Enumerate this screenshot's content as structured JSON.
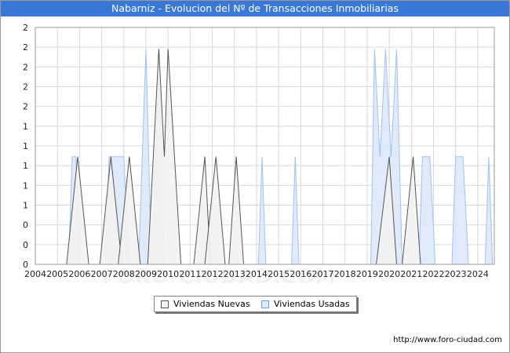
{
  "title": "Nabarniz - Evolucion del Nº de Transacciones Inmobiliarias",
  "source": "http://www.foro-ciudad.com",
  "watermark": "FORO-CIUDAD.COM",
  "legend": {
    "nuevas": "Viviendas Nuevas",
    "usadas": "Viviendas Usadas"
  },
  "colors": {
    "title_bg": "#3a78d8",
    "nuevas_fill": "#f2f2f2",
    "nuevas_stroke": "#555555",
    "usadas_fill": "#dbe9fb",
    "usadas_stroke": "#9dc3f0",
    "grid": "#d8d8d8"
  },
  "chart_data": {
    "type": "area",
    "title": "Nabarniz - Evolucion del Nº de Transacciones Inmobiliarias",
    "xlabel": "",
    "ylabel": "",
    "x_ticks": [
      "2004",
      "2005",
      "2006",
      "2007",
      "2008",
      "2009",
      "2010",
      "2011",
      "2012",
      "2013",
      "2014",
      "2015",
      "2016",
      "2017",
      "2018",
      "2019",
      "2020",
      "2021",
      "2022",
      "2023",
      "2024"
    ],
    "y_ticks": [
      "0",
      "0",
      "0",
      "1",
      "1",
      "1",
      "1",
      "1",
      "2",
      "2",
      "2",
      "2"
    ],
    "ylim": [
      0,
      2.2
    ],
    "grid": true,
    "legend_position": "bottom",
    "series": [
      {
        "name": "Viviendas Usadas",
        "points": [
          [
            "2005-07",
            0
          ],
          [
            "2005-09",
            1
          ],
          [
            "2005-11",
            1
          ],
          [
            "2006-01",
            0
          ],
          [
            "2007-03",
            0
          ],
          [
            "2007-05",
            1
          ],
          [
            "2007-08",
            1
          ],
          [
            "2007-10",
            1
          ],
          [
            "2008-01",
            1
          ],
          [
            "2008-04",
            0
          ],
          [
            "2008-09",
            0
          ],
          [
            "2009-01",
            2
          ],
          [
            "2009-04",
            0
          ],
          [
            "2009-05",
            0
          ],
          [
            "2009-08",
            2
          ],
          [
            "2009-11",
            0
          ],
          [
            "2014-02",
            0
          ],
          [
            "2014-04",
            1
          ],
          [
            "2014-06",
            0
          ],
          [
            "2015-08",
            0
          ],
          [
            "2015-10",
            1
          ],
          [
            "2015-12",
            0
          ],
          [
            "2019-03",
            0
          ],
          [
            "2019-05",
            2
          ],
          [
            "2019-08",
            1
          ],
          [
            "2019-11",
            2
          ],
          [
            "2020-02",
            1
          ],
          [
            "2020-05",
            2
          ],
          [
            "2020-08",
            0
          ],
          [
            "2021-05",
            0
          ],
          [
            "2021-07",
            1
          ],
          [
            "2021-11",
            1
          ],
          [
            "2022-02",
            0
          ],
          [
            "2022-11",
            0
          ],
          [
            "2023-01",
            1
          ],
          [
            "2023-05",
            1
          ],
          [
            "2023-08",
            0
          ],
          [
            "2024-05",
            0
          ],
          [
            "2024-07",
            1
          ],
          [
            "2024-09",
            0
          ]
        ]
      },
      {
        "name": "Viviendas Nuevas",
        "points": [
          [
            "2005-06",
            0
          ],
          [
            "2005-12",
            1
          ],
          [
            "2006-06",
            0
          ],
          [
            "2006-12",
            0
          ],
          [
            "2007-06",
            1
          ],
          [
            "2007-12",
            0
          ],
          [
            "2007-10",
            0
          ],
          [
            "2008-04",
            1
          ],
          [
            "2008-10",
            0
          ],
          [
            "2009-02",
            0
          ],
          [
            "2009-08",
            2
          ],
          [
            "2009-11",
            1
          ],
          [
            "2010-01",
            2
          ],
          [
            "2010-08",
            0
          ],
          [
            "2011-03",
            0
          ],
          [
            "2011-09",
            1
          ],
          [
            "2011-12",
            0
          ],
          [
            "2011-09",
            0
          ],
          [
            "2012-03",
            1
          ],
          [
            "2012-08",
            0
          ],
          [
            "2012-10",
            0
          ],
          [
            "2013-02",
            1
          ],
          [
            "2013-06",
            0
          ],
          [
            "2019-06",
            0
          ],
          [
            "2020-01",
            1
          ],
          [
            "2020-05",
            0
          ],
          [
            "2020-08",
            0
          ],
          [
            "2021-02",
            1
          ],
          [
            "2021-06",
            0
          ]
        ]
      }
    ]
  }
}
